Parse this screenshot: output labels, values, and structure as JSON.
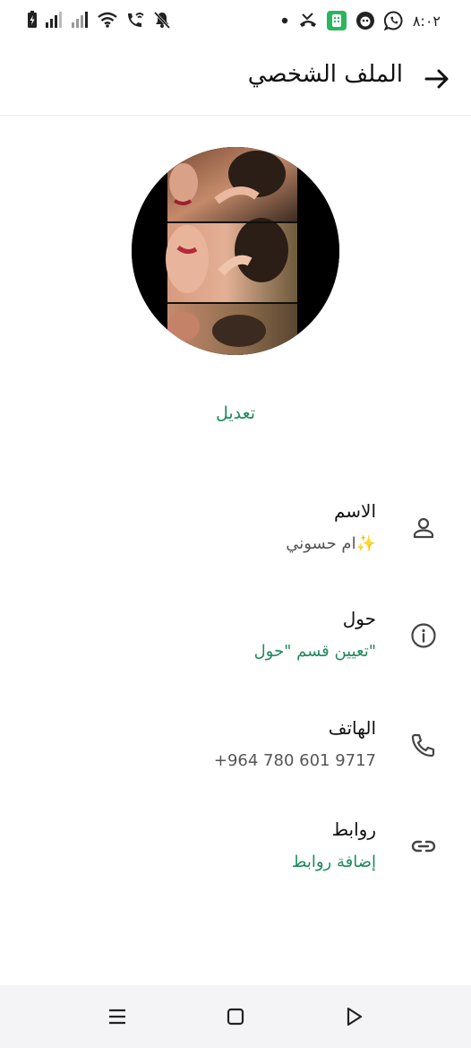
{
  "status_bar": {
    "time": "٨:٠٢",
    "left_icons": [
      "battery-charging-icon",
      "signal-icon",
      "signal-icon",
      "wifi-icon",
      "wifi-call-icon",
      "notifications-off-icon"
    ],
    "right_icons": [
      "dot-icon",
      "missed-call-icon",
      "app-icon",
      "app-icon",
      "whatsapp-icon"
    ]
  },
  "header": {
    "title": "الملف الشخصي",
    "back_icon": "arrow-back-icon"
  },
  "profile": {
    "edit_label": "تعديل"
  },
  "fields": [
    {
      "label": "الاسم",
      "value": "ام حسوني✨",
      "icon": "person-icon",
      "value_style": "normal"
    },
    {
      "label": "حول",
      "value": "تعيين قسم \"حول\"",
      "icon": "info-icon",
      "value_style": "accent"
    },
    {
      "label": "الهاتف",
      "value": "+964 780 601 9717",
      "icon": "phone-icon",
      "value_style": "normal"
    },
    {
      "label": "روابط",
      "value": "إضافة روابط",
      "icon": "link-icon",
      "value_style": "accent"
    }
  ],
  "nav_bar": {
    "buttons": [
      "menu-icon",
      "home-icon",
      "back-triangle-icon"
    ]
  },
  "colors": {
    "accent": "#1f8a5b",
    "background": "#ffffff",
    "nav_background": "#f4f4f6"
  }
}
